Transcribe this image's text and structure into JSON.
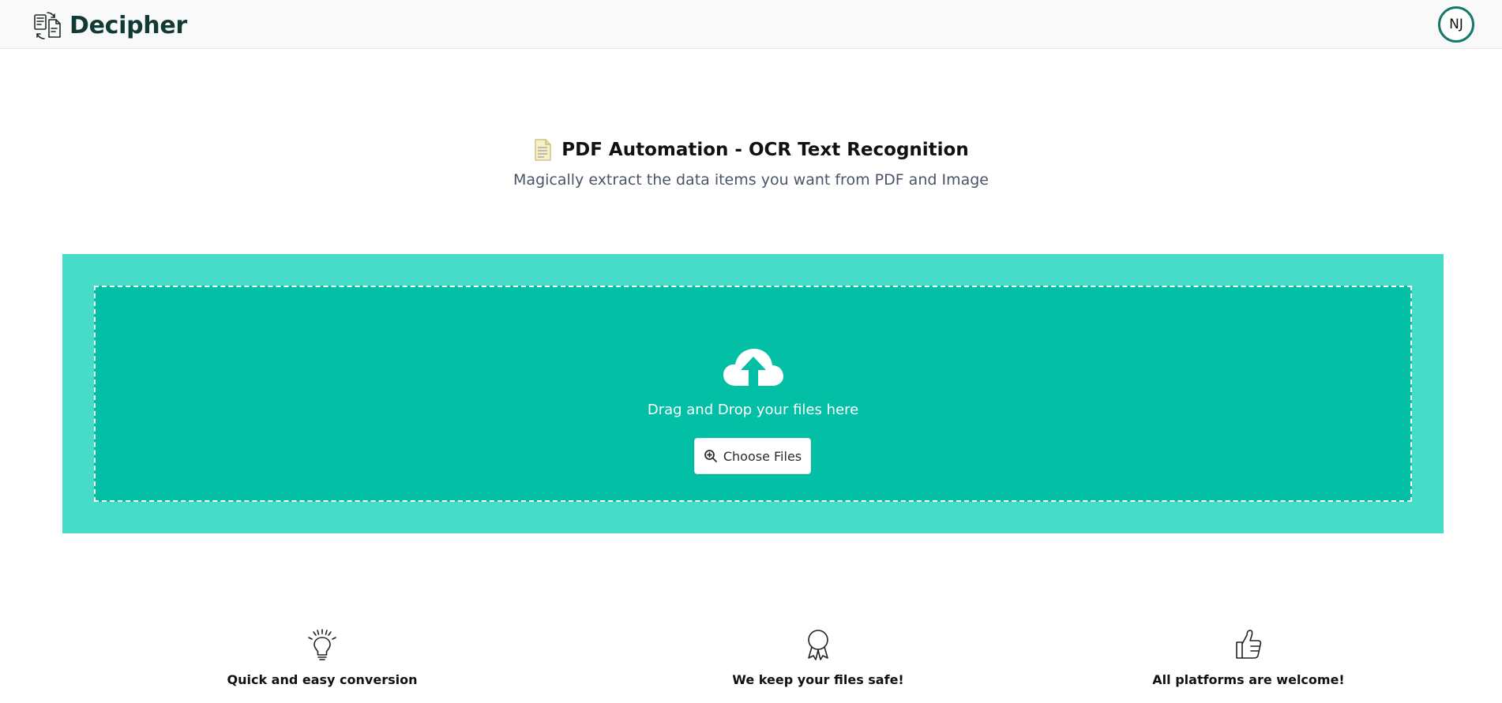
{
  "header": {
    "brand_name": "Decipher",
    "brand_icon": "documents-sync-icon",
    "avatar_initials": "NJ",
    "avatar_ring_color": "#17786a"
  },
  "hero": {
    "icon": "page-document-icon",
    "title": "PDF Automation - OCR Text Recognition",
    "subtitle": "Magically extract the data items you want from PDF and Image"
  },
  "upload": {
    "icon": "cloud-upload-icon",
    "drop_text": "Drag and Drop your files here",
    "button_icon": "search-plus-icon",
    "button_label": "Choose Files",
    "outer_color": "#47dcc8",
    "inner_color": "#02bfa6"
  },
  "features": [
    {
      "icon": "lightbulb-icon",
      "label": "Quick and easy conversion"
    },
    {
      "icon": "award-ribbon-icon",
      "label": "We keep your files safe!"
    },
    {
      "icon": "thumbs-up-icon",
      "label": "All platforms are welcome!"
    }
  ]
}
